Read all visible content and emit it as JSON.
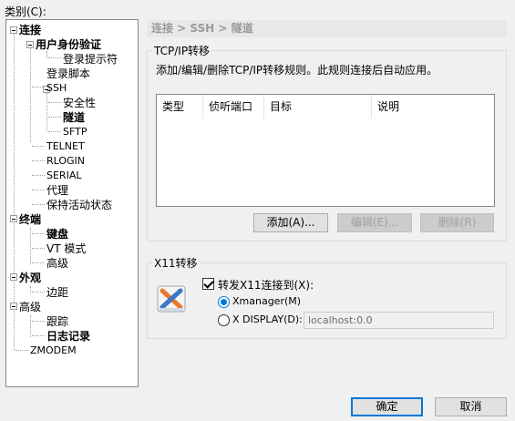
{
  "category_label": "类别(C):",
  "breadcrumb": "连接 > SSH > 隧道",
  "tree": {
    "connection": "连接",
    "auth": "用户身份验证",
    "login_prompt": "登录提示符",
    "login_script": "登录脚本",
    "ssh": "SSH",
    "security": "安全性",
    "tunnel": "隧道",
    "sftp": "SFTP",
    "telnet": "TELNET",
    "rlogin": "RLOGIN",
    "serial": "SERIAL",
    "proxy": "代理",
    "keepalive": "保持活动状态",
    "terminal": "终端",
    "keyboard": "键盘",
    "vt_mode": "VT 模式",
    "terminal_advanced": "高级",
    "appearance": "外观",
    "margin": "边距",
    "advanced": "高级",
    "trace": "跟踪",
    "logging": "日志记录",
    "zmodem": "ZMODEM"
  },
  "tcpip": {
    "group_title": "TCP/IP转移",
    "description": "添加/编辑/删除TCP/IP转移规则。此规则连接后自动应用。",
    "columns": [
      "类型",
      "侦听端口",
      "目标",
      "说明"
    ],
    "add_button": "添加(A)...",
    "edit_button": "编辑(E)...",
    "delete_button": "删除(R)"
  },
  "x11": {
    "group_title": "X11转移",
    "forward_checkbox": "转发X11连接到(X):",
    "forward_checked": true,
    "xmanager_option": "Xmanager(M)",
    "xdisplay_option": "X DISPLAY(D):",
    "selected_option": "xmanager",
    "display_value": "localhost:0.0"
  },
  "footer": {
    "ok_button": "确定",
    "cancel_button": "取消"
  },
  "colors": {
    "accent": "#0078d7",
    "x11_icon_orange": "#e8792c",
    "x11_icon_blue": "#3a78c8"
  }
}
